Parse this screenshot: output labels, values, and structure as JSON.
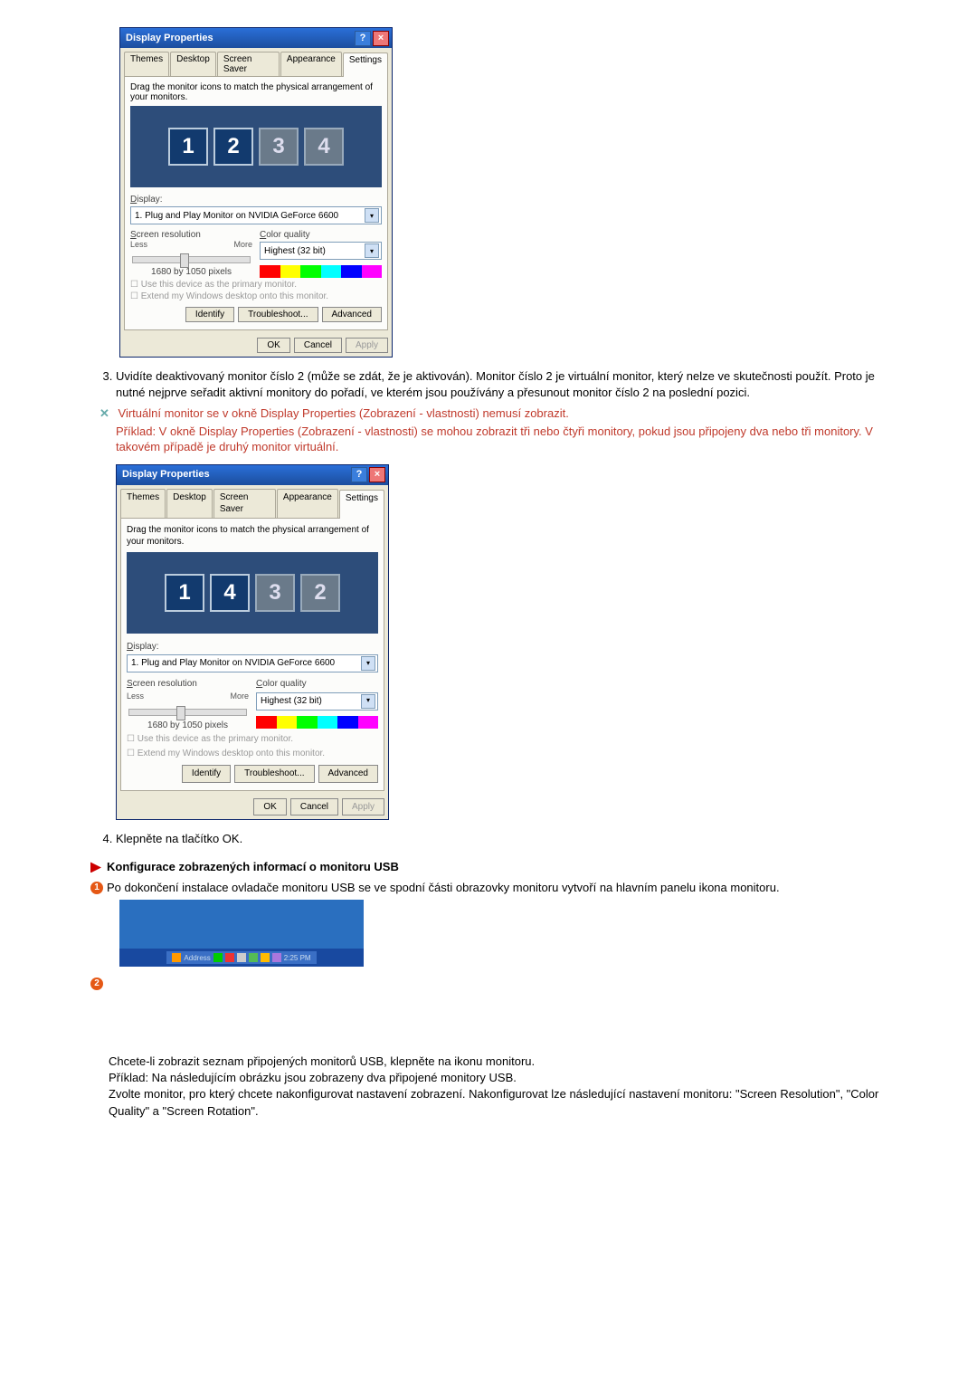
{
  "dialog": {
    "title": "Display Properties",
    "tabs": [
      "Themes",
      "Desktop",
      "Screen Saver",
      "Appearance",
      "Settings"
    ],
    "active_tab": "Settings",
    "instruction": "Drag the monitor icons to match the physical arrangement of your monitors.",
    "display_label": "Display:",
    "display_dropdown": "1. Plug and Play Monitor on NVIDIA GeForce 6600",
    "screen_res_label": "Screen resolution",
    "less": "Less",
    "more": "More",
    "resolution": "1680 by 1050 pixels",
    "color_quality_label": "Color quality",
    "color_quality_value": "Highest (32 bit)",
    "chk1": "Use this device as the primary monitor.",
    "chk2": "Extend my Windows desktop onto this monitor.",
    "identify": "Identify",
    "troubleshoot": "Troubleshoot...",
    "advanced": "Advanced",
    "ok": "OK",
    "cancel": "Cancel",
    "apply": "Apply"
  },
  "monitors_a": [
    "1",
    "2",
    "3",
    "4"
  ],
  "monitors_b": [
    "1",
    "4",
    "3",
    "2"
  ],
  "list3": "Uvidíte deaktivovaný monitor číslo 2 (může se zdát, že je aktivován). Monitor číslo 2 je virtuální monitor, který nelze ve skutečnosti použít. Proto je nutné nejprve seřadit aktivní monitory do pořadí, ve kterém jsou používány a přesunout monitor číslo 2 na poslední pozici.",
  "note1": "Virtuální monitor se v okně Display Properties (Zobrazení - vlastnosti) nemusí zobrazit.",
  "note2": "Příklad: V okně Display Properties (Zobrazení - vlastnosti) se mohou zobrazit tři nebo čtyři monitory, pokud jsou připojeny dva nebo tři monitory. V takovém případě je druhý monitor virtuální.",
  "list4": "Klepněte na tlačítko OK.",
  "heading2": "Konfigurace zobrazených informací o monitoru USB",
  "bullet1": "Po dokončení instalace ovladače monitoru USB se ve spodní části obrazovky monitoru vytvoří na hlavním panelu ikona monitoru.",
  "taskbar_text": "Address",
  "taskbar_time": "2:25 PM",
  "para2a": "Chcete-li zobrazit seznam připojených monitorů USB, klepněte na ikonu monitoru.",
  "para2b": "Příklad: Na následujícím obrázku jsou zobrazeny dva připojené monitory USB.",
  "para2c": "Zvolte monitor, pro který chcete nakonfigurovat nastavení zobrazení. Nakonfigurovat lze následující nastavení monitoru: \"Screen Resolution\", \"Color Quality\" a \"Screen Rotation\".",
  "circle1": "1",
  "circle2": "2"
}
